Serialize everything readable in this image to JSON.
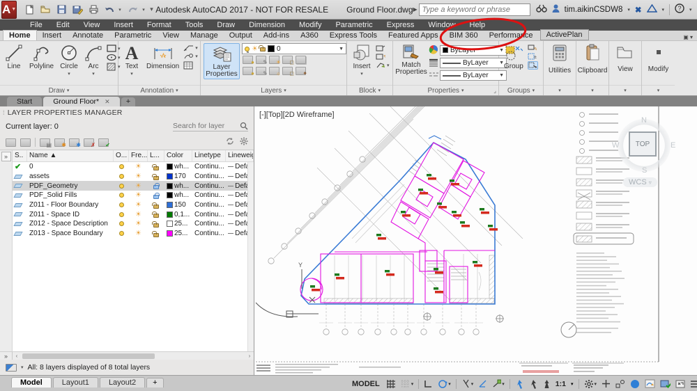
{
  "titlebar": {
    "title": "Autodesk AutoCAD 2017 - NOT FOR RESALE",
    "doc_name": "Ground Floor.dwg",
    "search_placeholder": "Type a keyword or phrase",
    "user": "tim.aikinCSDW8",
    "minimize": "–",
    "maximize": "□",
    "close": "✕"
  },
  "menubar": {
    "items": [
      "File",
      "Edit",
      "View",
      "Insert",
      "Format",
      "Tools",
      "Draw",
      "Dimension",
      "Modify",
      "Parametric",
      "Express",
      "Window",
      "Help"
    ]
  },
  "ribbon_tabs": {
    "items": [
      "Home",
      "Insert",
      "Annotate",
      "Parametric",
      "View",
      "Manage",
      "Output",
      "Add-ins",
      "A360",
      "Express Tools",
      "Featured Apps",
      "BIM 360",
      "Performance",
      "ActivePlan"
    ],
    "active": "Home",
    "circled": "ActivePlan"
  },
  "ribbon": {
    "draw": {
      "label": "Draw",
      "line": "Line",
      "polyline": "Polyline",
      "circle": "Circle",
      "arc": "Arc"
    },
    "annotation": {
      "label": "Annotation",
      "text": "Text",
      "dimension": "Dimension"
    },
    "layers": {
      "label": "Layers",
      "layer_properties_1": "Layer",
      "layer_properties_2": "Properties",
      "combo_value": "0"
    },
    "block": {
      "label": "Block",
      "insert": "Insert"
    },
    "properties": {
      "label": "Properties",
      "match_1": "Match",
      "match_2": "Properties",
      "color_value": "ByLayer",
      "lineweight_value": "ByLayer",
      "linetype_value": "ByLayer"
    },
    "groups": {
      "label": "Groups",
      "group": "Group"
    },
    "collapsed": [
      {
        "label": "Utilities"
      },
      {
        "label": "Clipboard"
      },
      {
        "label": "View"
      },
      {
        "label": "Modify"
      }
    ]
  },
  "file_tabs": {
    "start": "Start",
    "active_doc": "Ground Floor*",
    "close": "✕",
    "add": "+"
  },
  "layer_palette": {
    "title": "LAYER PROPERTIES MANAGER",
    "current_layer": "Current layer: 0",
    "search_placeholder": "Search for layer",
    "columns": [
      "S..",
      "Name",
      "O...",
      "Fre...",
      "L...",
      "Color",
      "Linetype",
      "Lineweig.."
    ],
    "linetype_value": "Continu...",
    "lineweight_value": "Defa.",
    "rows": [
      {
        "name": "0",
        "color_label": "wh...",
        "color": "#000000",
        "current": true,
        "locked": false,
        "selected": false
      },
      {
        "name": "assets",
        "color_label": "170",
        "color": "#0033cc",
        "current": false,
        "locked": false,
        "selected": false
      },
      {
        "name": "PDF_Geometry",
        "color_label": "wh...",
        "color": "#000000",
        "current": false,
        "locked": true,
        "selected": true
      },
      {
        "name": "PDF_Solid Fills",
        "color_label": "wh...",
        "color": "#000000",
        "current": false,
        "locked": true,
        "selected": false
      },
      {
        "name": "Z011 - Floor Boundary",
        "color_label": "150",
        "color": "#2e6fd6",
        "current": false,
        "locked": false,
        "selected": false
      },
      {
        "name": "Z011 - Space ID",
        "color_label": "0,1...",
        "color": "#007a00",
        "current": false,
        "locked": false,
        "selected": false
      },
      {
        "name": "Z012 - Space Description",
        "color_label": "25...",
        "color": "#ffffff",
        "current": false,
        "locked": false,
        "selected": false
      },
      {
        "name": "Z013 - Space Boundary",
        "color_label": "25...",
        "color": "#ff00ff",
        "current": false,
        "locked": false,
        "selected": false
      }
    ],
    "status": "All: 8 layers displayed of 8 total layers"
  },
  "canvas": {
    "viewport_label": "[-][Top][2D Wireframe]",
    "viewcube": {
      "top": "TOP",
      "n": "N",
      "s": "S",
      "e": "E",
      "w": "W",
      "wcs": "WCS"
    }
  },
  "statusbar": {
    "model_tabs": [
      "Model",
      "Layout1",
      "Layout2"
    ],
    "active_tab": "Model",
    "add_tab": "+",
    "model_label": "MODEL",
    "scale": "1:1"
  },
  "colors": {
    "accent_blue": "#2f7fd6",
    "boundary_blue": "#3a7bd5",
    "space_magenta": "#e214e2",
    "marker_red": "#d42a1e",
    "marker_green": "#1e7a1e",
    "annotation_red": "#dd1111",
    "highlight_btn": "#cfe3f7"
  }
}
